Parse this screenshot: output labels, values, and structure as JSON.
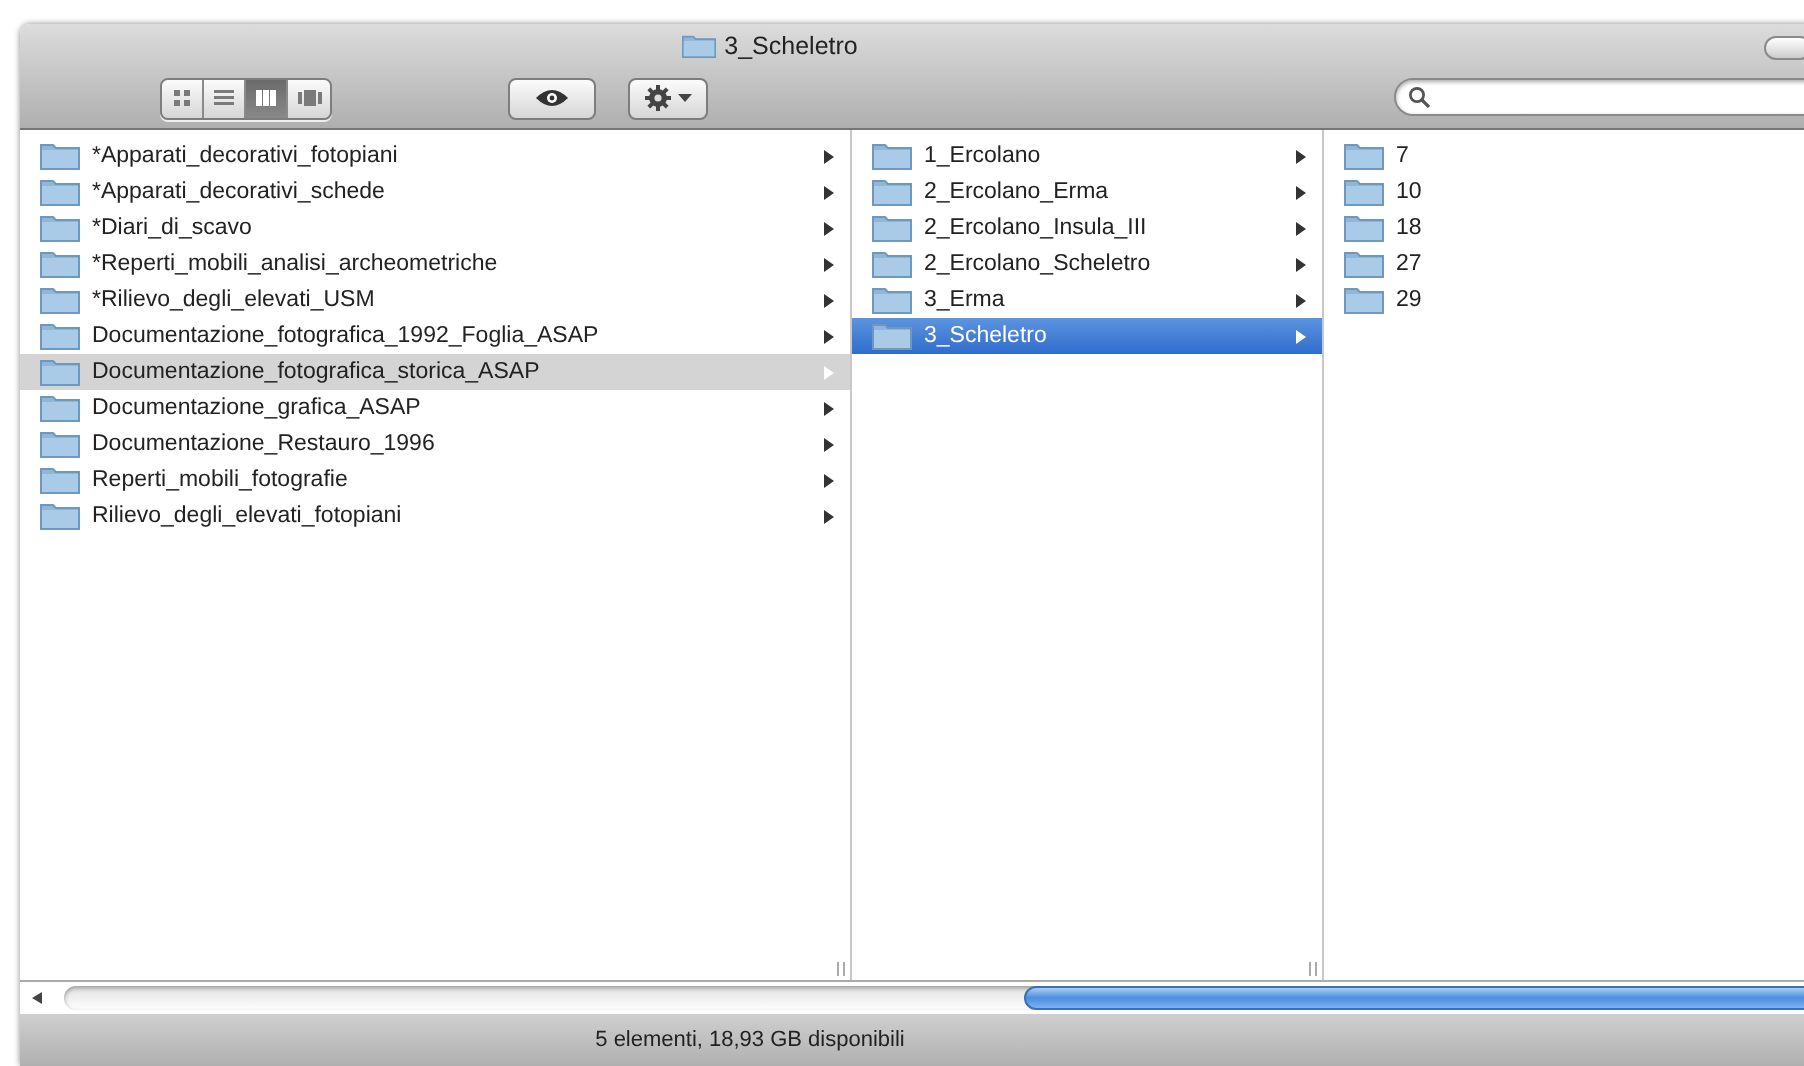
{
  "window": {
    "title": "3_Scheletro"
  },
  "toolbar": {
    "view_modes": [
      {
        "kind": "icons",
        "selected": false
      },
      {
        "kind": "list",
        "selected": false
      },
      {
        "kind": "columns",
        "selected": true
      },
      {
        "kind": "coverflow",
        "selected": false
      }
    ]
  },
  "columns": [
    {
      "focused": false,
      "items": [
        {
          "name": "*Apparati_decorativi_fotopiani",
          "selected": false
        },
        {
          "name": "*Apparati_decorativi_schede",
          "selected": false
        },
        {
          "name": "*Diari_di_scavo",
          "selected": false
        },
        {
          "name": "*Reperti_mobili_analisi_archeometriche",
          "selected": false
        },
        {
          "name": "*Rilievo_degli_elevati_USM",
          "selected": false
        },
        {
          "name": "Documentazione_fotografica_1992_Foglia_ASAP",
          "selected": false
        },
        {
          "name": "Documentazione_fotografica_storica_ASAP",
          "selected": true
        },
        {
          "name": "Documentazione_grafica_ASAP",
          "selected": false
        },
        {
          "name": "Documentazione_Restauro_1996",
          "selected": false
        },
        {
          "name": "Reperti_mobili_fotografie",
          "selected": false
        },
        {
          "name": "Rilievo_degli_elevati_fotopiani",
          "selected": false
        }
      ]
    },
    {
      "focused": true,
      "items": [
        {
          "name": "1_Ercolano",
          "selected": false
        },
        {
          "name": "2_Ercolano_Erma",
          "selected": false
        },
        {
          "name": "2_Ercolano_Insula_III",
          "selected": false
        },
        {
          "name": "2_Ercolano_Scheletro",
          "selected": false
        },
        {
          "name": "3_Erma",
          "selected": false
        },
        {
          "name": "3_Scheletro",
          "selected": true
        }
      ]
    },
    {
      "items": [
        {
          "name": "7",
          "selected": false
        },
        {
          "name": "10",
          "selected": false
        },
        {
          "name": "18",
          "selected": false
        },
        {
          "name": "27",
          "selected": false
        },
        {
          "name": "29",
          "selected": false
        }
      ]
    }
  ],
  "status_bar": {
    "text": "5 elementi, 18,93 GB disponibili"
  }
}
